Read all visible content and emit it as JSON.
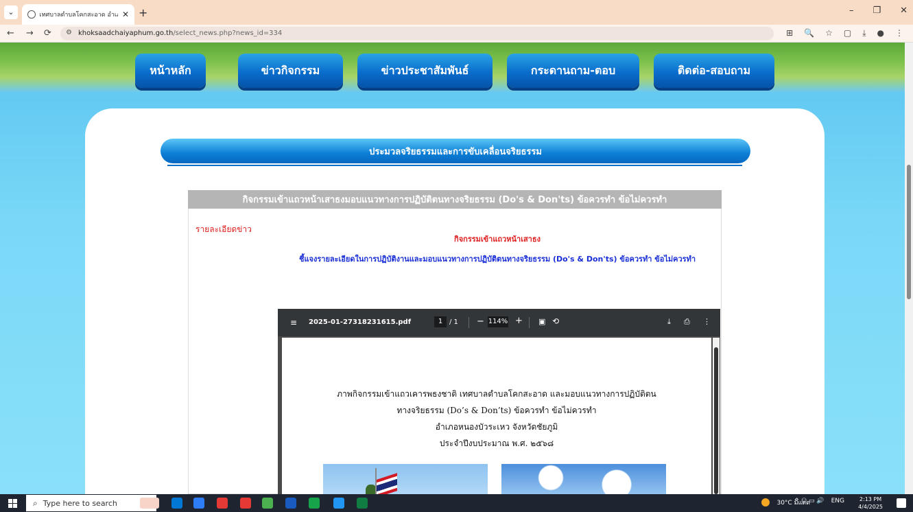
{
  "browser": {
    "tab_title": "เทศบาลตำบลโคกสะอาด อำเภอหนองบัวระเหว",
    "tab_close": "✕",
    "new_tab": "+",
    "tab_menu": "⌄",
    "window_controls": {
      "minimize": "–",
      "maximize": "❐",
      "close": "✕"
    },
    "nav": {
      "back": "←",
      "forward": "→",
      "reload": "⟳"
    },
    "url_host": "khoksaadchaiyaphum.go.th",
    "url_path": "/select_news.php?news_id=334",
    "right_icons": [
      "⊞",
      "🔍",
      "☆",
      "▢",
      "⤓",
      "●",
      "⋮"
    ]
  },
  "nav_menu": {
    "home": "หน้าหลัก",
    "activities": "ข่าวกิจกรรม",
    "pr_news": "ข่าวประชาสัมพันธ์",
    "qa_board": "กระดานถาม-ตอบ",
    "contact": "ติดต่อ-สอบถาม"
  },
  "section": {
    "banner": "ประมวลจริยธรรมและการขับเคลื่อนจริยธรรม"
  },
  "news": {
    "header": "กิจกรรมเข้าแถวหน้าเสาธงมอบแนวทางการปฏิบัติตนทางจริยธรรม (Do's & Don'ts) ข้อควรทำ ข้อไม่ควรทำ",
    "detail_label": "รายละเอียดข่าว",
    "title": "กิจกรรมเข้าแถวหน้าเสาธง",
    "subtitle": "ชี้แจงรายละเอียดในการปฏิบัติงานและมอบแนวทางการปฏิบัติตนทางจริยธรรม (Do's & Don'ts) ข้อควรทำ ข้อไม่ควรทำ"
  },
  "pdf": {
    "filename": "2025-01-27318231615.pdf",
    "page_current": "1",
    "page_total": "/ 1",
    "zoom": "114%",
    "lines": [
      "ภาพกิจกรรมเข้าแถวเคารพธงชาติ เทศบาลตำบลโคกสะอาด และมอบแนวทางการปฏิบัติตน",
      "ทางจริยธรรม (Do’s & Don’ts) ข้อควรทำ ข้อไม่ควรทำ",
      "อำเภอหนองบัวระเหว  จังหวัดชัยภูมิ",
      "ประจำปีงบประมาณ พ.ศ. ๒๕๖๘"
    ]
  },
  "taskbar": {
    "search_placeholder": "Type here to search",
    "weather": "30°C มีแดด",
    "tray_icons": "^ ⚇ ▭ 🔊",
    "lang": "ENG",
    "time": "2:13 PM",
    "date": "4/4/2025",
    "app_colors": [
      "#f7d3c8",
      "#0078d4",
      "#2f7df6",
      "#e53935",
      "#e53935",
      "#4caf50",
      "#185abd",
      "#16a34a",
      "#2196f3",
      "#107c41"
    ]
  }
}
